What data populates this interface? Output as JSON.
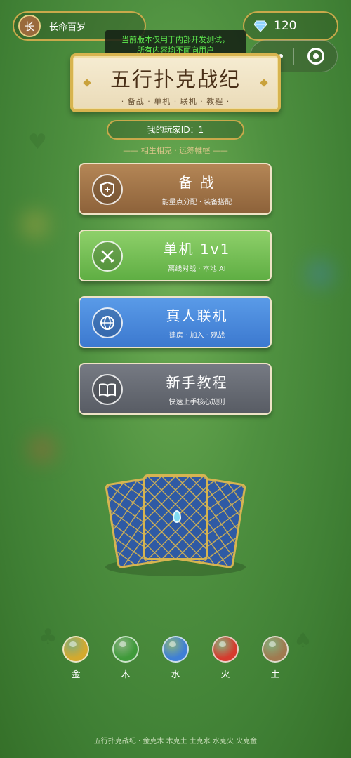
{
  "user": {
    "avatar_char": "长",
    "name": "长命百岁"
  },
  "currency": {
    "gems": "120",
    "icon": "diamond-gem-icon"
  },
  "notice": {
    "line1": "当前版本仅用于内部开发测试，",
    "line2": "所有内容均不面向用户"
  },
  "title": {
    "main": "五行扑克战纪",
    "sub": "· 备战 · 单机 · 联机 · 教程 ·"
  },
  "player": {
    "id_text": "我的玩家ID：1"
  },
  "motto": "—— 相生相克 · 运筹帷幄 ——",
  "menu": [
    {
      "label": "备 战",
      "desc": "能量点分配 · 装备搭配",
      "icon": "shield-plus-icon",
      "color": "#a2764a"
    },
    {
      "label": "单机 1v1",
      "desc": "离线对战 · 本地 AI",
      "icon": "crossed-swords-icon",
      "color": "#76be56"
    },
    {
      "label": "真人联机",
      "desc": "建房 · 加入 · 观战",
      "icon": "globe-icon",
      "color": "#4a8adb"
    },
    {
      "label": "新手教程",
      "desc": "快速上手核心规则",
      "icon": "open-book-icon",
      "color": "#666a73"
    }
  ],
  "elements": [
    {
      "label": "金",
      "color": "#d4a92e"
    },
    {
      "label": "木",
      "color": "#3f9a3a"
    },
    {
      "label": "水",
      "color": "#3f7fd6"
    },
    {
      "label": "火",
      "color": "#d63b2e"
    },
    {
      "label": "土",
      "color": "#a07a50"
    }
  ],
  "footer": "五行扑克战纪 · 金克木 木克土 土克水 水克火 火克金"
}
